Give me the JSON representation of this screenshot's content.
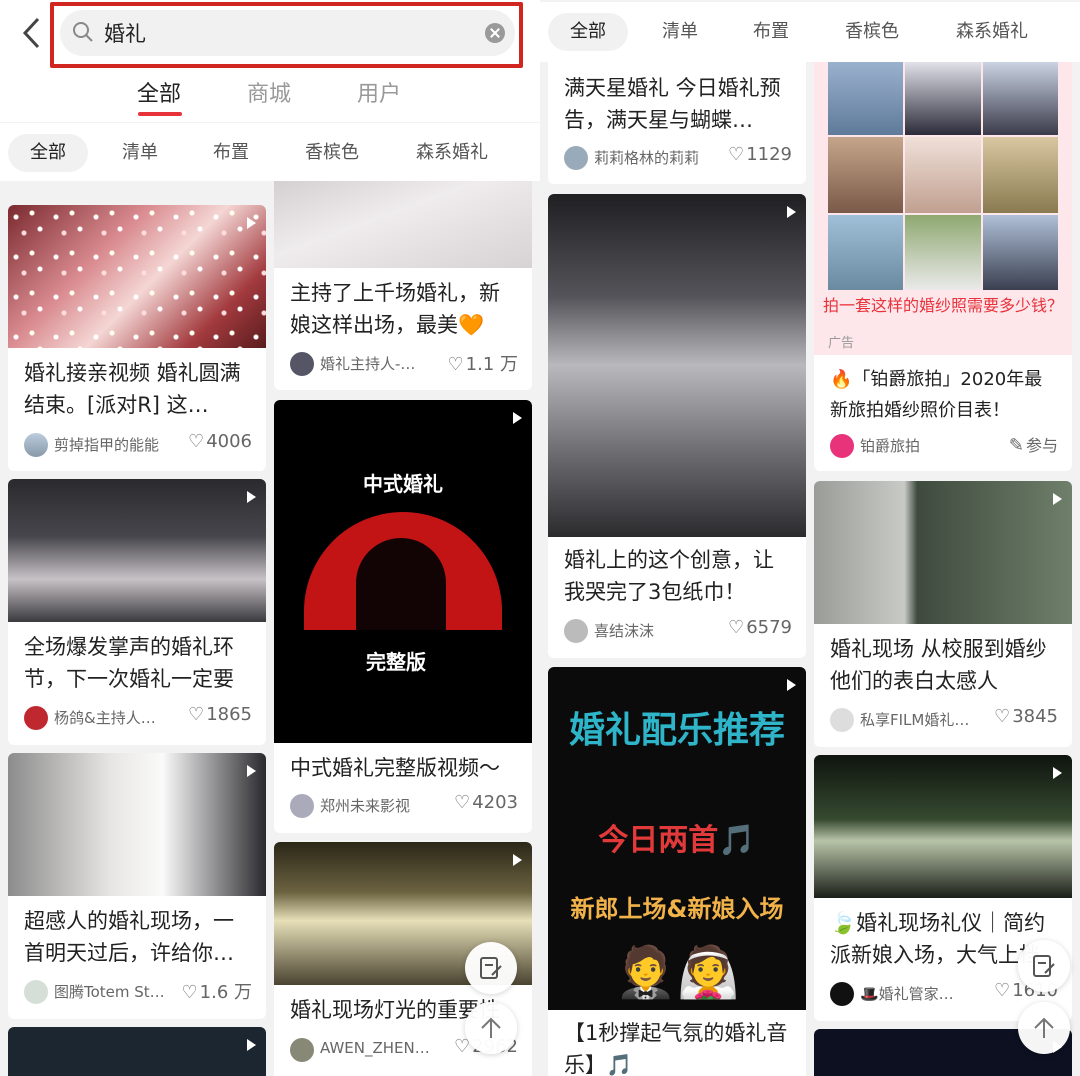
{
  "search": {
    "query": "婚礼"
  },
  "scopes": [
    "全部",
    "商城",
    "用户"
  ],
  "chips": [
    "全部",
    "清单",
    "布置",
    "香槟色",
    "森系婚礼"
  ],
  "left": {
    "cards": [
      {
        "title": "婚礼接亲视频 婚礼圆满结束。[派对R] 这…",
        "author": "剪掉指甲的能能",
        "likes": "4006"
      },
      {
        "title": "主持了上千场婚礼，新娘这样出场，最美🧡",
        "author": "婚礼主持人-…",
        "likes": "1.1 万"
      },
      {
        "title": "全场爆发掌声的婚礼环节，下一次婚礼一定要",
        "author": "杨鸽&主持人…",
        "likes": "1865"
      },
      {
        "title": "中式婚礼完整版视频～",
        "author": "郑州未来影视",
        "likes": "4203",
        "thumb_text_top": "中式婚礼",
        "thumb_text_bottom": "完整版"
      },
      {
        "title": "超感人的婚礼现场，一首明天过后，许给你…",
        "author": "图腾Totem St…",
        "likes": "1.6 万"
      },
      {
        "title": "婚礼现场灯光的重要性",
        "author": "AWEN_ZHEN…",
        "likes": "2962"
      }
    ]
  },
  "right": {
    "cards": [
      {
        "title": "满天星婚礼 今日婚礼预告，满天星与蝴蝶…",
        "author": "莉莉格林的莉莉",
        "likes": "1129"
      },
      {
        "title": "🔥「铂爵旅拍」2020年最新旅拍婚纱照价目表！",
        "author": "铂爵旅拍",
        "action": "参与",
        "ad_banner": "拍一套这样的婚纱照需要多少钱？",
        "ad_label": "广告"
      },
      {
        "title": "婚礼上的这个创意，让我哭完了3包纸巾！",
        "author": "喜结沫沫",
        "likes": "6579"
      },
      {
        "title": "婚礼现场 从校服到婚纱 他们的表白太感人",
        "author": "私享FILM婚礼…",
        "likes": "3845"
      },
      {
        "title": "【1秒撑起气氛的婚礼音乐】🎵",
        "author": "",
        "likes": "",
        "thumb_text_1": "婚礼配乐推荐",
        "thumb_text_2": "今日两首🎵",
        "thumb_text_3": "新郎上场&新娘入场",
        "thumb_emoji": "🤵👰"
      },
      {
        "title": "🍃婚礼现场礼仪｜简约派新娘入场，大气上档次",
        "author": "🎩婚礼管家…",
        "likes": "1610"
      }
    ]
  },
  "colors": {
    "accent": "#e8323c",
    "highlight_box": "#d0261f"
  }
}
